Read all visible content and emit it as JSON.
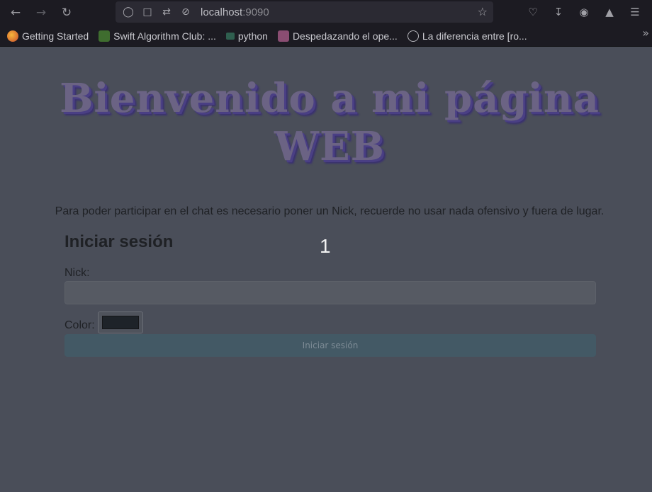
{
  "browser": {
    "url_host": "localhost",
    "url_port": ":9090",
    "bookmarks": [
      {
        "label": "Getting Started",
        "icon": "firefox-icon"
      },
      {
        "label": "Swift Algorithm Club: ...",
        "icon": "swift-icon"
      },
      {
        "label": "python",
        "icon": "python-icon"
      },
      {
        "label": "Despedazando el ope...",
        "icon": "site-icon"
      },
      {
        "label": "La diferencia entre [ro...",
        "icon": "globe-icon"
      }
    ]
  },
  "page": {
    "heading": "Bienvenido a mi página WEB",
    "intro": "Para poder participar en el chat es necesario poner un Nick, recuerde no usar nada ofensivo y fuera de lugar.",
    "login_title": "Iniciar sesión",
    "badge": "1",
    "nick_label": "Nick:",
    "nick_value": "",
    "color_label": "Color:",
    "color_value": "#1e2329",
    "submit_label": "Iniciar sesión"
  },
  "colors": {
    "page_bg": "#4a4e59",
    "button_bg": "#435965",
    "heading_color": "#6b6384"
  }
}
